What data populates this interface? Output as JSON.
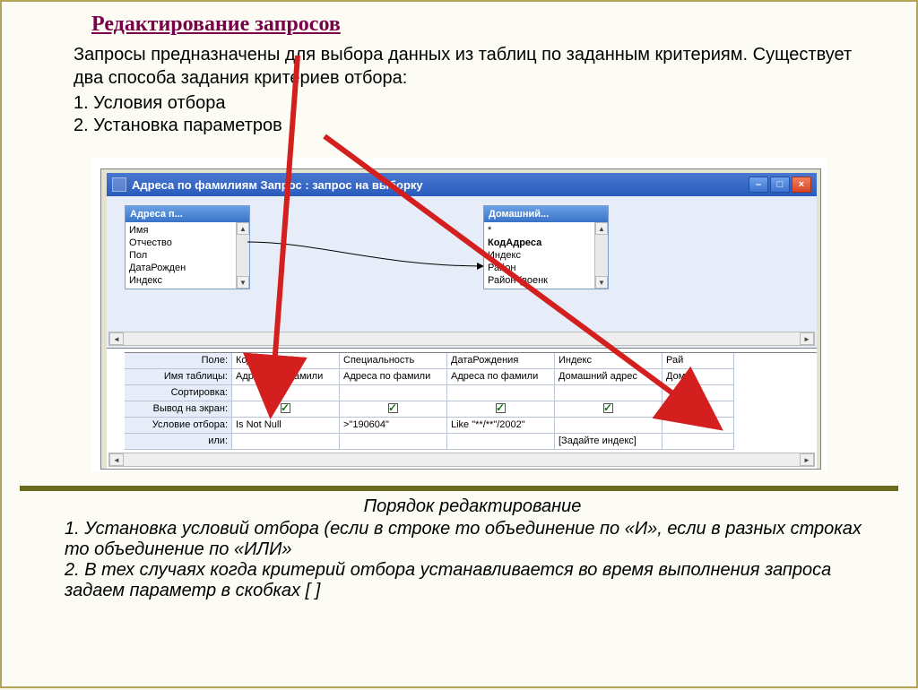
{
  "title": "Редактирование запросов",
  "intro": "Запросы предназначены для выбора данных из таблиц по заданным критериям. Существует два способа задания критериев отбора:",
  "list": [
    "1.   Условия отбора",
    "2.   Установка параметров"
  ],
  "window": {
    "title": "Адреса по фамилиям Запрос : запрос на выборку",
    "box1": {
      "header": "Адреса п...",
      "fields": [
        "Имя",
        "Отчество",
        "Пол",
        "ДатаРожден",
        "Индекс"
      ]
    },
    "box2": {
      "header": "Домашний...",
      "fields": [
        "*",
        "КодАдреса",
        "Индекс",
        "Район",
        "Район (военк"
      ]
    }
  },
  "grid": {
    "row_labels": [
      "Поле:",
      "Имя таблицы:",
      "Сортировка:",
      "Вывод на экран:",
      "Условие отбора:",
      "или:"
    ],
    "columns": [
      {
        "field": "КодАдреса",
        "table": "Адреса по фамили",
        "cond": "Is Not Null",
        "or": ""
      },
      {
        "field": "Специальность",
        "table": "Адреса по фамили",
        "cond": ">\"190604\"",
        "or": ""
      },
      {
        "field": "ДатаРождения",
        "table": "Адреса по фамили",
        "cond": "Like \"**/**\"/2002\"",
        "or": ""
      },
      {
        "field": "Индекс",
        "table": "Домашний адрес",
        "cond": "",
        "or": "[Задайте индекс]"
      },
      {
        "field": "Рай",
        "table": "Дом",
        "cond": "",
        "or": ""
      }
    ]
  },
  "post": {
    "header": "Порядок редактирование",
    "items": [
      "1.    Установка условий отбора (если в строке то объединение по «И», если в разных строках то объединение по «ИЛИ»",
      "2.   В тех случаях когда критерий отбора устанавливается во время выполнения запроса задаем параметр в скобках [ ]"
    ]
  }
}
